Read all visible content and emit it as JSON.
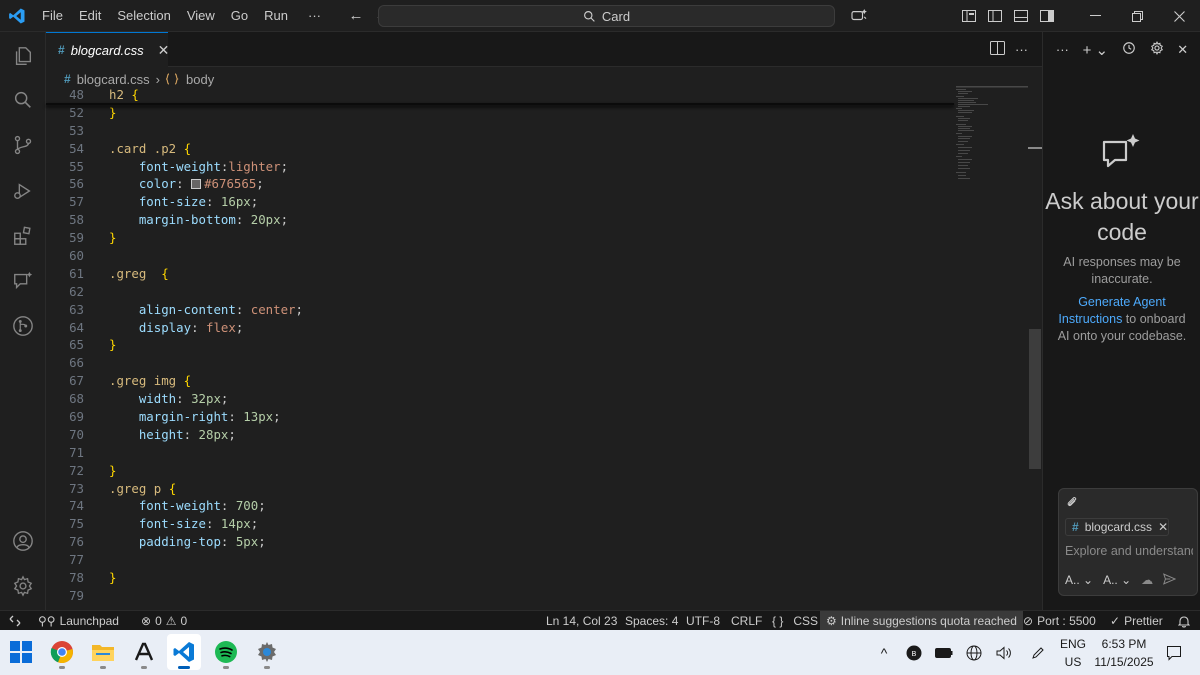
{
  "titlebar": {
    "menu": [
      "File",
      "Edit",
      "Selection",
      "View",
      "Go",
      "Run"
    ],
    "more": "···",
    "search_text": "Card"
  },
  "tab": {
    "icon_text": "#",
    "label": "blogcard.css"
  },
  "breadcrumb": {
    "file": "blogcard.css",
    "symbol": "body"
  },
  "code_lines": [
    {
      "n": "48",
      "html": "<span class='sel'>h2</span> <span class='brace'>{</span>"
    },
    {
      "n": "52",
      "html": "<span class='brace'>}</span>"
    },
    {
      "n": "53",
      "html": ""
    },
    {
      "n": "54",
      "html": "<span class='sel'>.card .p2</span> <span class='brace'>{</span>"
    },
    {
      "n": "55",
      "html": "    <span class='prop'>font-weight</span><span class='punc'>:</span><span class='val'>lighter</span><span class='punc'>;</span>"
    },
    {
      "n": "56",
      "html": "    <span class='prop'>color</span><span class='punc'>: </span><span class='swatch'></span><span class='val'>#676565</span><span class='punc'>;</span>"
    },
    {
      "n": "57",
      "html": "    <span class='prop'>font-size</span><span class='punc'>: </span><span class='num'>16px</span><span class='punc'>;</span>"
    },
    {
      "n": "58",
      "html": "    <span class='prop'>margin-bottom</span><span class='punc'>: </span><span class='num'>20px</span><span class='punc'>;</span>"
    },
    {
      "n": "59",
      "html": "<span class='brace'>}</span>"
    },
    {
      "n": "60",
      "html": ""
    },
    {
      "n": "61",
      "html": "<span class='sel'>.greg</span>  <span class='brace'>{</span>"
    },
    {
      "n": "62",
      "html": ""
    },
    {
      "n": "63",
      "html": "    <span class='prop'>align-content</span><span class='punc'>: </span><span class='val'>center</span><span class='punc'>;</span>"
    },
    {
      "n": "64",
      "html": "    <span class='prop'>display</span><span class='punc'>: </span><span class='val'>flex</span><span class='punc'>;</span>"
    },
    {
      "n": "65",
      "html": "<span class='brace'>}</span>"
    },
    {
      "n": "66",
      "html": ""
    },
    {
      "n": "67",
      "html": "<span class='sel'>.greg img</span> <span class='brace'>{</span>"
    },
    {
      "n": "68",
      "html": "    <span class='prop'>width</span><span class='punc'>: </span><span class='num'>32px</span><span class='punc'>;</span>"
    },
    {
      "n": "69",
      "html": "    <span class='prop'>margin-right</span><span class='punc'>: </span><span class='num'>13px</span><span class='punc'>;</span>"
    },
    {
      "n": "70",
      "html": "    <span class='prop'>height</span><span class='punc'>: </span><span class='num'>28px</span><span class='punc'>;</span>"
    },
    {
      "n": "71",
      "html": ""
    },
    {
      "n": "72",
      "html": "<span class='brace'>}</span>"
    },
    {
      "n": "73",
      "html": "<span class='sel'>.greg p</span> <span class='brace'>{</span>"
    },
    {
      "n": "74",
      "html": "    <span class='prop'>font-weight</span><span class='punc'>: </span><span class='num'>700</span><span class='punc'>;</span>"
    },
    {
      "n": "75",
      "html": "    <span class='prop'>font-size</span><span class='punc'>: </span><span class='num'>14px</span><span class='punc'>;</span>"
    },
    {
      "n": "76",
      "html": "    <span class='prop'>padding-top</span><span class='punc'>: </span><span class='num'>5px</span><span class='punc'>;</span>"
    },
    {
      "n": "77",
      "html": ""
    },
    {
      "n": "78",
      "html": "<span class='brace'>}</span>"
    },
    {
      "n": "79",
      "html": ""
    }
  ],
  "chat": {
    "title": "Ask about your code",
    "subtitle": "AI responses may be inaccurate.",
    "link": "Generate Agent Instructions",
    "link_suffix": " to onboard AI onto your codebase.",
    "context_file": "blogcard.css",
    "input_placeholder": "Explore and understand",
    "mode_label": "A..",
    "model_label": "A.."
  },
  "statusbar": {
    "launchpad": "Launchpad",
    "errors": "0",
    "warnings": "0",
    "position": "Ln 14, Col 23",
    "spaces": "Spaces: 4",
    "encoding": "UTF-8",
    "eol": "CRLF",
    "braces": "{ }",
    "language": "CSS",
    "suggestions": "Inline suggestions quota reached",
    "port": "Port : 5500",
    "prettier": "Prettier"
  },
  "taskbar": {
    "lang_top": "ENG",
    "lang_bottom": "US",
    "time": "6:53 PM",
    "date": "11/15/2025"
  },
  "colors": {
    "accent": "#0078d4",
    "link": "#4daafc",
    "selector": "#d7ba7d",
    "property": "#9cdcfe",
    "number": "#b5cea8",
    "string": "#ce9178",
    "brace": "#ffd700"
  }
}
